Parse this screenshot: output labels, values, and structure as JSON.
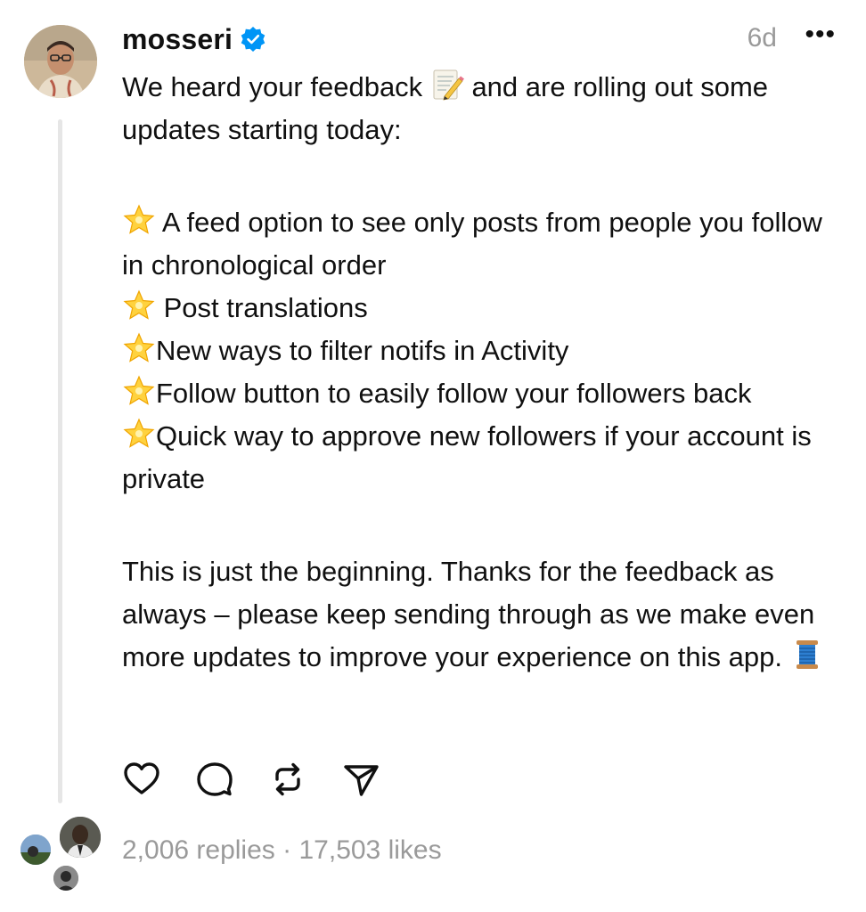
{
  "post": {
    "username": "mosseri",
    "verified": true,
    "time_ago": "6d",
    "more_label": "•••",
    "intro_text_1": "We heard your feedback",
    "intro_emoji": "memo-emoji",
    "intro_text_2": "and are rolling out some updates starting today:",
    "bullet_emoji": "glowing-star-emoji",
    "bullets": [
      {
        "text": " A feed option to see only posts from people you follow in chronological order"
      },
      {
        "text": " Post translations"
      },
      {
        "text": "New ways to filter notifs in Activity"
      },
      {
        "text": "Follow button to easily follow your followers back"
      },
      {
        "text": "Quick way to approve new followers if your account is private"
      }
    ],
    "closing_text": "This is just the beginning. Thanks for the feedback as always – please keep sending through as we make even more updates to improve your experience on this app.",
    "closing_emoji": "spool-of-thread-emoji"
  },
  "actions": {
    "like_icon": "heart-icon",
    "reply_icon": "comment-icon",
    "repost_icon": "repost-icon",
    "share_icon": "send-icon"
  },
  "stats": {
    "replies": "2,006 replies",
    "separator": "·",
    "likes": "17,503 likes"
  },
  "colors": {
    "text": "#101010",
    "muted": "#9a9a9a",
    "verified_blue": "#0095f6",
    "thread_line": "#e6e6e6"
  }
}
